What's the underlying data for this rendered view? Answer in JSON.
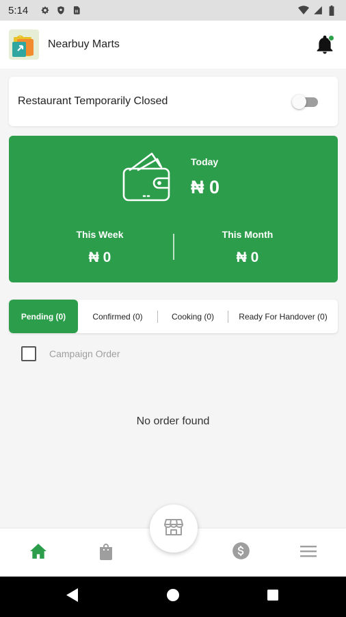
{
  "status_bar": {
    "time": "5:14",
    "left_icons": [
      "gear-icon",
      "shield-icon",
      "sim-card-icon"
    ],
    "right_icons": [
      "wifi-icon",
      "signal-icon",
      "battery-icon"
    ]
  },
  "header": {
    "store_name": "Nearbuy Marts",
    "notification_dot_color": "#2ea14b"
  },
  "closed_toggle": {
    "label": "Restaurant Temporarily Closed",
    "state": "off"
  },
  "earnings": {
    "background_color": "#2c9e4b",
    "today_label": "Today",
    "today_value": "₦ 0",
    "week_label": "This Week",
    "week_value": "₦ 0",
    "month_label": "This Month",
    "month_value": "₦ 0"
  },
  "tabs": [
    {
      "label": "Pending (0)",
      "active": true
    },
    {
      "label": "Confirmed (0)",
      "active": false
    },
    {
      "label": "Cooking (0)",
      "active": false
    },
    {
      "label": "Ready For Handover (0)",
      "active": false
    }
  ],
  "campaign": {
    "label": "Campaign Order",
    "checked": false
  },
  "empty_message": "No order found",
  "bottom_nav": {
    "items": [
      "home-icon",
      "shopping-bag-icon",
      "store-icon",
      "dollar-icon",
      "menu-icon"
    ],
    "active_item": "home-icon",
    "active_color": "#2c9e4b",
    "inactive_color": "#9e9e9e"
  },
  "system_nav": [
    "back-icon",
    "home-circle-icon",
    "recents-icon"
  ]
}
